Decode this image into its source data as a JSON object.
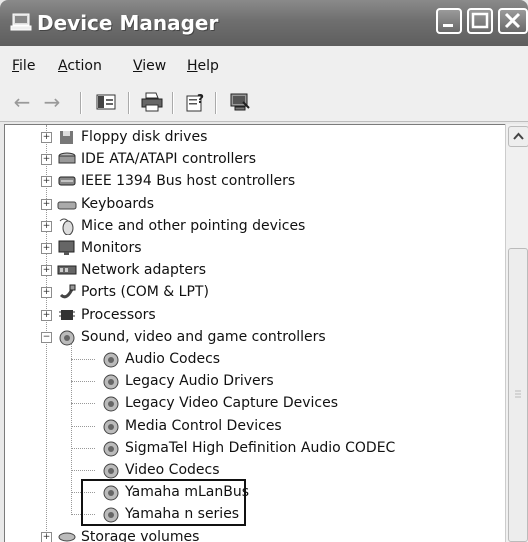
{
  "window": {
    "title": "Device Manager"
  },
  "menu": [
    {
      "accel": "F",
      "rest": "ile"
    },
    {
      "accel": "A",
      "rest": "ction"
    },
    {
      "accel": "V",
      "rest": "iew"
    },
    {
      "accel": "H",
      "rest": "elp"
    }
  ],
  "toolbar": {
    "back": "←",
    "forward": "→"
  },
  "tree": {
    "categories": [
      {
        "label": "Floppy disk drives",
        "icon": "floppy-icon",
        "expanded": false
      },
      {
        "label": "IDE ATA/ATAPI controllers",
        "icon": "ide-icon",
        "expanded": false
      },
      {
        "label": "IEEE 1394 Bus host controllers",
        "icon": "ieee1394-icon",
        "expanded": false
      },
      {
        "label": "Keyboards",
        "icon": "keyboard-icon",
        "expanded": false
      },
      {
        "label": "Mice and other pointing devices",
        "icon": "mouse-icon",
        "expanded": false
      },
      {
        "label": "Monitors",
        "icon": "monitor-icon",
        "expanded": false
      },
      {
        "label": "Network adapters",
        "icon": "network-icon",
        "expanded": false
      },
      {
        "label": "Ports (COM & LPT)",
        "icon": "port-icon",
        "expanded": false
      },
      {
        "label": "Processors",
        "icon": "processor-icon",
        "expanded": false
      },
      {
        "label": "Sound, video and game controllers",
        "icon": "sound-icon",
        "expanded": true
      }
    ],
    "sound_children": [
      "Audio Codecs",
      "Legacy Audio Drivers",
      "Legacy Video Capture Devices",
      "Media Control Devices",
      "SigmaTel High Definition Audio CODEC",
      "Video Codecs",
      "Yamaha mLanBus",
      "Yamaha n series"
    ],
    "last_category": {
      "label": "Storage volumes",
      "icon": "storage-icon",
      "expanded": false
    }
  }
}
